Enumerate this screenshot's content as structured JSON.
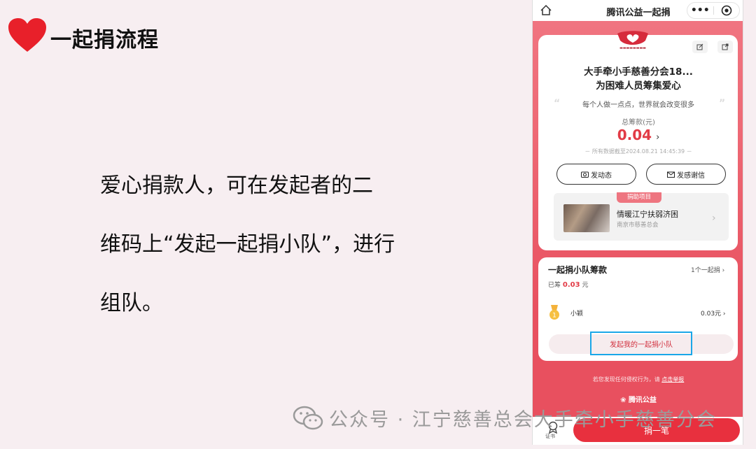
{
  "slide": {
    "title": "一起捐流程",
    "body_lines": [
      "爱心捐款人，可在发起者的二",
      "维码上“发起一起捐小队”，进行",
      "组队。"
    ]
  },
  "watermark": "公众号 · 江宁慈善总会大手牵小手慈善分会",
  "phone": {
    "nav_title": "腾讯公益一起捐",
    "menu_glyph": "•••",
    "project": {
      "title_line1": "大手牵小手慈善分会18...",
      "title_line2": "为困难人员筹集爱心",
      "quote": "每个人做一点点，世界就会改变很多",
      "total_label": "总筹款(元)",
      "total_value": "0.04",
      "data_time": "－ 所有数据截至2024.08.21 14:45:39 －",
      "btn_post": "发动态",
      "btn_thanks": "发感谢信"
    },
    "aided": {
      "tag": "捐助项目",
      "name": "情暖江宁扶弱济困",
      "org": "南京市慈善总会"
    },
    "team": {
      "title": "一起捐小队筹款",
      "link": "1个一起捐",
      "raised_prefix": "已筹",
      "raised_amount": "0.03",
      "raised_unit": "元",
      "member_name": "小颖",
      "member_amount": "0.03元",
      "cta": "发起我的一起捐小队"
    },
    "report_text": "若您发现任何侵权行为，请",
    "report_link": "点击举报",
    "brand": "腾讯公益",
    "cert_label": "证书",
    "donate": "捐一笔"
  },
  "colors": {
    "brand_red": "#e8303e",
    "highlight_border": "#1aa7e8"
  }
}
